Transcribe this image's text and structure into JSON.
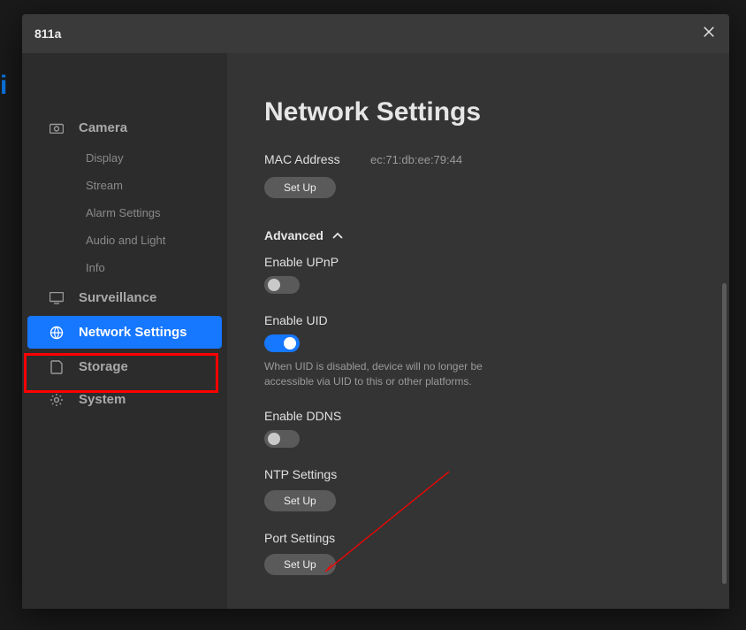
{
  "window": {
    "title": "811a"
  },
  "sidebar": {
    "groups": [
      {
        "name": "camera",
        "label": "Camera",
        "subs": [
          {
            "name": "display",
            "label": "Display"
          },
          {
            "name": "stream",
            "label": "Stream"
          },
          {
            "name": "alarm-settings",
            "label": "Alarm Settings"
          },
          {
            "name": "audio-and-light",
            "label": "Audio and Light"
          },
          {
            "name": "info",
            "label": "Info"
          }
        ]
      },
      {
        "name": "surveillance",
        "label": "Surveillance"
      },
      {
        "name": "network-settings",
        "label": "Network Settings",
        "active": true
      },
      {
        "name": "storage",
        "label": "Storage"
      },
      {
        "name": "system",
        "label": "System"
      }
    ]
  },
  "page": {
    "title": "Network Settings",
    "mac_label": "MAC Address",
    "mac_value": "ec:71:db:ee:79:44",
    "setup_label": "Set Up",
    "advanced_label": "Advanced",
    "upnp_label": "Enable UPnP",
    "upnp_on": false,
    "uid_label": "Enable UID",
    "uid_on": true,
    "uid_hint": "When UID is disabled, device will no longer be accessible via UID to this or other platforms.",
    "ddns_label": "Enable DDNS",
    "ddns_on": false,
    "ntp_label": "NTP Settings",
    "port_label": "Port Settings"
  }
}
